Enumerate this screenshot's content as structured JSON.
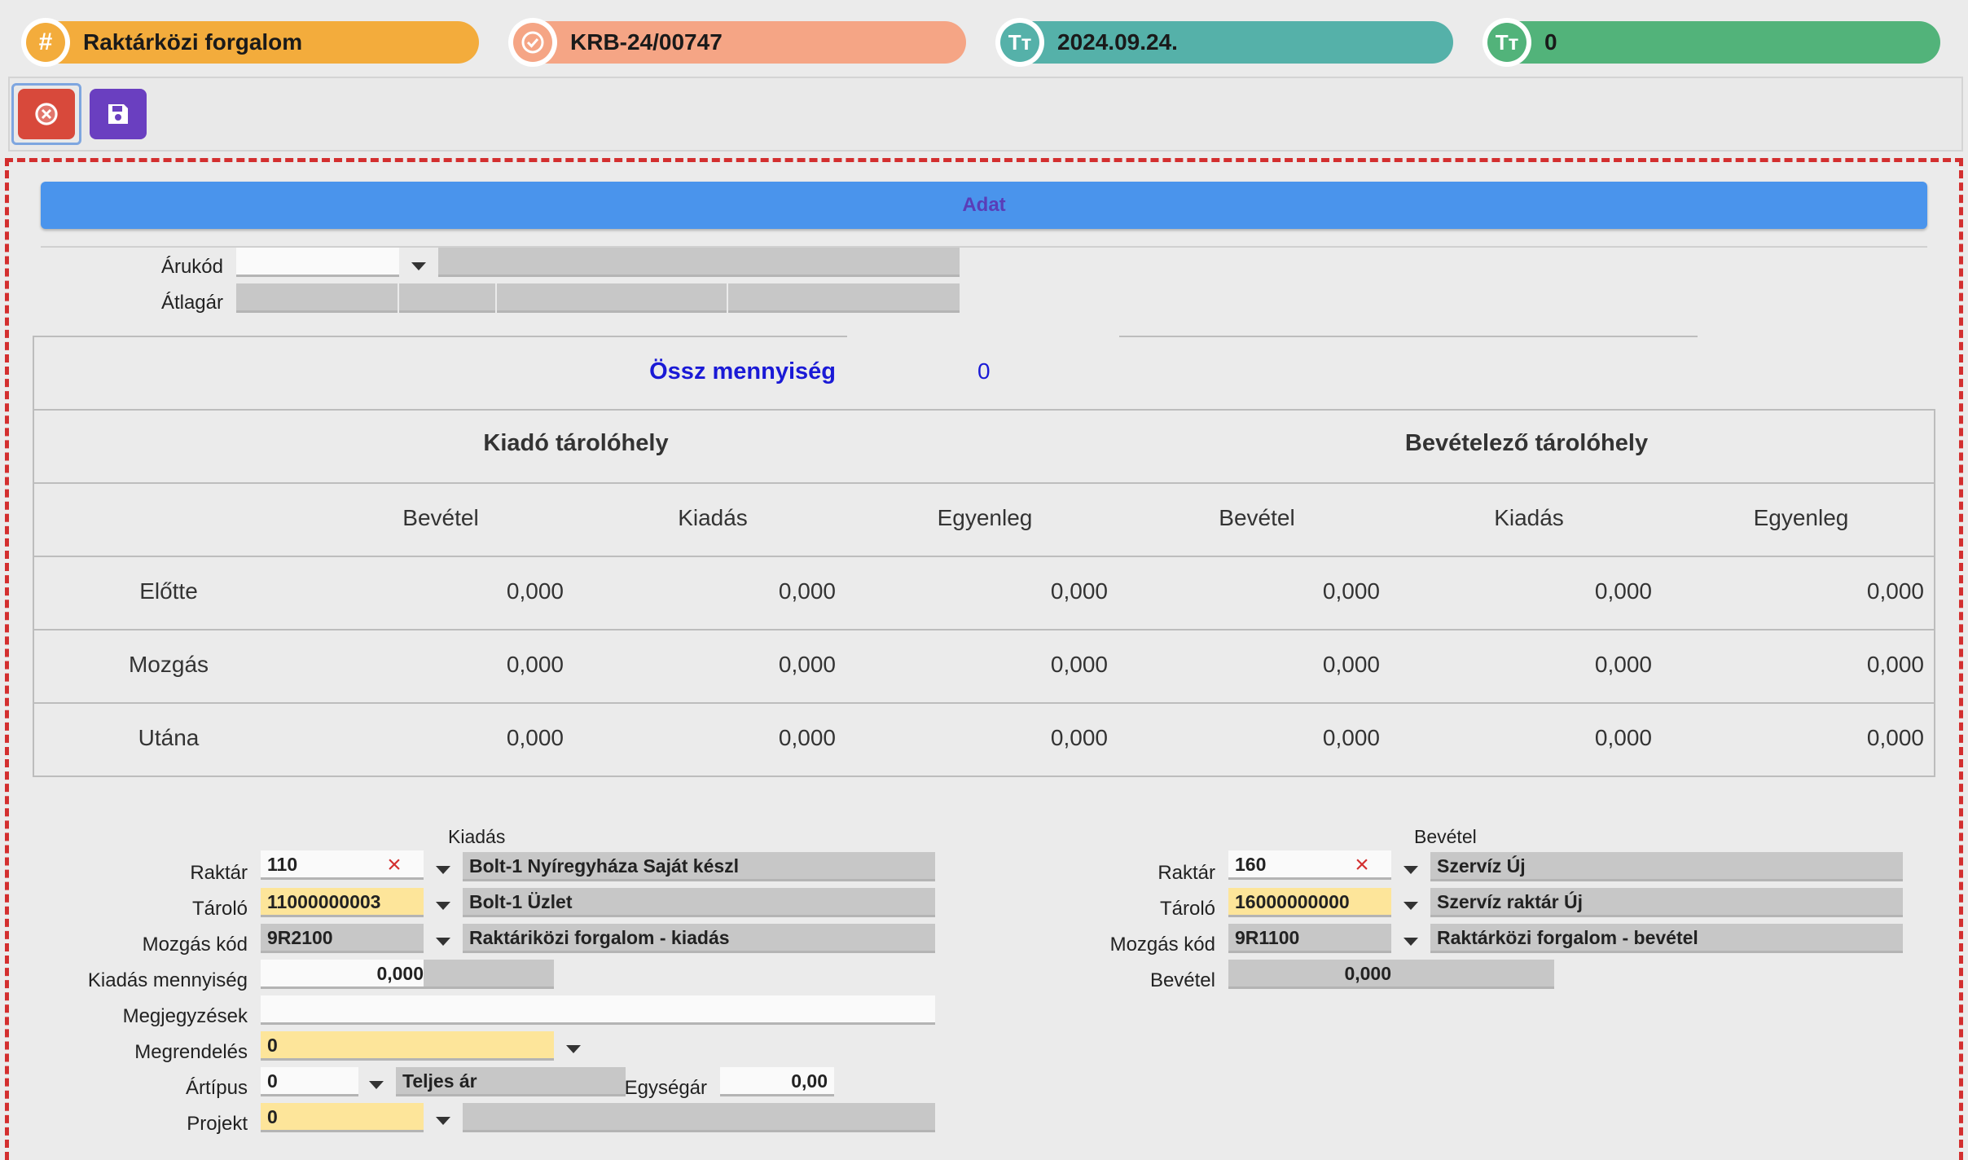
{
  "header": {
    "pills": [
      {
        "name": "transaction-type",
        "text": "Raktárközi forgalom",
        "color": "#f3ac3c",
        "icon": "hash-icon"
      },
      {
        "name": "document-number",
        "text": "KRB-24/00747",
        "color": "#f5a585",
        "icon": "check-badge-icon"
      },
      {
        "name": "document-date",
        "text": "2024.09.24.",
        "color": "#55b1a9",
        "icon": "text-size-icon"
      },
      {
        "name": "status-value",
        "text": "0",
        "color": "#52b37a",
        "icon": "text-size-icon"
      }
    ]
  },
  "toolbar": {
    "cancel": "cancel-icon",
    "save": "save-icon"
  },
  "section_title": "Adat",
  "product": {
    "code_label": "Árukód",
    "code_value": "",
    "name_value": "",
    "avg_price_label": "Átlagár"
  },
  "table": {
    "total_label": "Össz mennyiség",
    "total_value": "0",
    "group_out": "Kiadó tárolóhely",
    "group_in": "Bevételező tárolóhely",
    "columns": [
      "Bevétel",
      "Kiadás",
      "Egyenleg",
      "Bevétel",
      "Kiadás",
      "Egyenleg"
    ],
    "rows": [
      {
        "label": "Előtte",
        "values": [
          "0,000",
          "0,000",
          "0,000",
          "0,000",
          "0,000",
          "0,000"
        ]
      },
      {
        "label": "Mozgás",
        "values": [
          "0,000",
          "0,000",
          "0,000",
          "0,000",
          "0,000",
          "0,000"
        ]
      },
      {
        "label": "Utána",
        "values": [
          "0,000",
          "0,000",
          "0,000",
          "0,000",
          "0,000",
          "0,000"
        ]
      }
    ]
  },
  "issue": {
    "title": "Kiadás",
    "warehouse_label": "Raktár",
    "warehouse_code": "110",
    "warehouse_name": "Bolt-1 Nyíregyháza Saját készl",
    "storage_label": "Tároló",
    "storage_code": "11000000003",
    "storage_name": "Bolt-1 Üzlet",
    "move_label": "Mozgás kód",
    "move_code": "9R2100",
    "move_name": "Raktáriközi forgalom - kiadás",
    "qty_label": "Kiadás mennyiség",
    "qty_value": "0,000",
    "notes_label": "Megjegyzések",
    "notes_value": "",
    "order_label": "Megrendelés",
    "order_value": "0",
    "price_type_label": "Ártípus",
    "price_type_code": "0",
    "price_type_name": "Teljes ár",
    "unit_price_label": "Egységár",
    "unit_price_value": "0,00",
    "project_label": "Projekt",
    "project_value": "0"
  },
  "receipt": {
    "title": "Bevétel",
    "warehouse_label": "Raktár",
    "warehouse_code": "160",
    "warehouse_name": "Szervíz Új",
    "storage_label": "Tároló",
    "storage_code": "16000000000",
    "storage_name": "Szervíz raktár Új",
    "move_label": "Mozgás kód",
    "move_code": "9R1100",
    "move_name": "Raktárközi forgalom - bevétel",
    "qty_label": "Bevétel",
    "qty_value": "0,000"
  }
}
